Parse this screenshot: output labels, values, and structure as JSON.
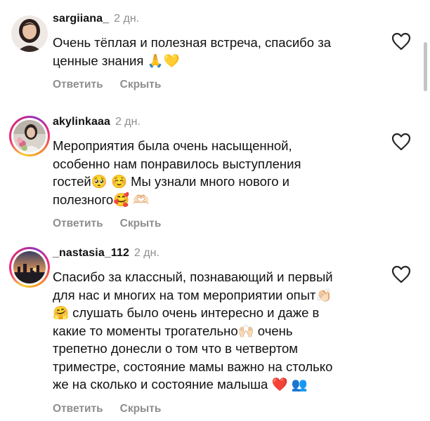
{
  "actions": {
    "reply": "Ответить",
    "hide": "Скрыть"
  },
  "comments": [
    {
      "username": "sargiiana_",
      "time": "2 дн.",
      "text": "Очень тёплая и полезная встреча, спасибо за\nценные знания 🙏💛",
      "has_story_ring": false
    },
    {
      "username": "akylinkaaa",
      "time": "2 дн.",
      "text": "Мероприятия была очень насыщенной,\nособенно нам понравилось выступления\nгостей🥺 ☺️ Мы узнали много нового и\nполезного🥰 🫶🏻",
      "has_story_ring": true
    },
    {
      "username": "_nastasia_112",
      "time": "2 дн.",
      "text": "Спасибо за классный, познавающий  и первый\nдля нас и многих на том мероприятии опыт👏🏻\n🤗 слушать было очень интересно и даже в\nкакие то моменты трогательно🙌🏻 очень\nтрепетно донесли о том что в четвертом\nтриместре, состояние мамы важно на столько\nже на сколько и состояние малыша ❤️ 👥",
      "has_story_ring": true
    }
  ],
  "icons": {
    "like": "heart-outline-icon"
  },
  "colors": {
    "secondary_text": "#8e8e8e",
    "primary_text": "#111111",
    "story_ring": "#d62976"
  }
}
